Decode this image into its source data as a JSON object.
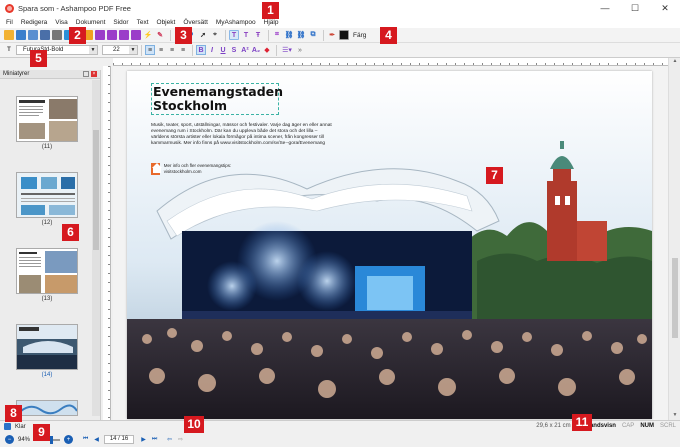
{
  "window": {
    "title": "Spara som - Ashampoo PDF Free",
    "minimize": "—",
    "maximize": "☐",
    "close": "✕"
  },
  "menu": [
    "Fil",
    "Redigera",
    "Visa",
    "Dokument",
    "Sidor",
    "Text",
    "Objekt",
    "Översätt",
    "MyAshampoo",
    "Hjälp"
  ],
  "toolbar": {
    "color_label": "Färg"
  },
  "format": {
    "font": "FuturaStd-Bold",
    "size": "22"
  },
  "thumbnails": {
    "title": "Miniatyrer",
    "pages": [
      {
        "label": "(11)"
      },
      {
        "label": "(12)"
      },
      {
        "label": "(13)"
      },
      {
        "label": "(14)"
      }
    ]
  },
  "document": {
    "headline": "Evenemangstaden Stockholm",
    "body": "Musik, teater, sport, utställningar, mässor och festivaler. Varje dag äger en eller annat evenemang rum i Stockholm. Där kan du uppleva både det stora och det lilla – världens största artister eller lokala förmågor på intima scener, från kongresser till kammarmusik. Mer info finns på www.visitstockholm.com/sv/Se--gora/Evenemang",
    "link": "Mer info och fler evenemangstips: visitstockholm.com"
  },
  "status": {
    "ready": "Klar",
    "page_size": "29,6 x 21 cm",
    "mode": "Förhandsvisn",
    "cap": "CAP",
    "num": "NUM",
    "scrl": "SCRL"
  },
  "nav": {
    "zoom": "94%",
    "page": "14 / 16"
  },
  "badges": [
    "1",
    "2",
    "3",
    "4",
    "5",
    "6",
    "7",
    "8",
    "9",
    "10",
    "11"
  ],
  "colors": {
    "badge": "#d6191f",
    "accent": "#1a5fb4"
  }
}
